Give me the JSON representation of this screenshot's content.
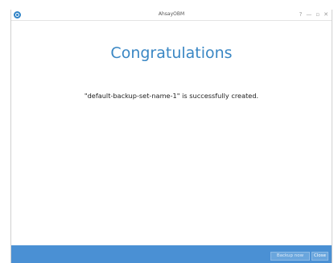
{
  "window": {
    "title": "AhsayOBM",
    "controls": {
      "help": "?",
      "minimize": "—",
      "maximize": "▫",
      "close": "✕"
    }
  },
  "main": {
    "heading": "Congratulations",
    "message": "\"default-backup-set-name-1\" is successfully created."
  },
  "footer": {
    "backup_now_label": "Backup now",
    "close_label": "Close"
  },
  "colors": {
    "accent": "#3a87c4",
    "footer_bg": "#4a90d4"
  }
}
